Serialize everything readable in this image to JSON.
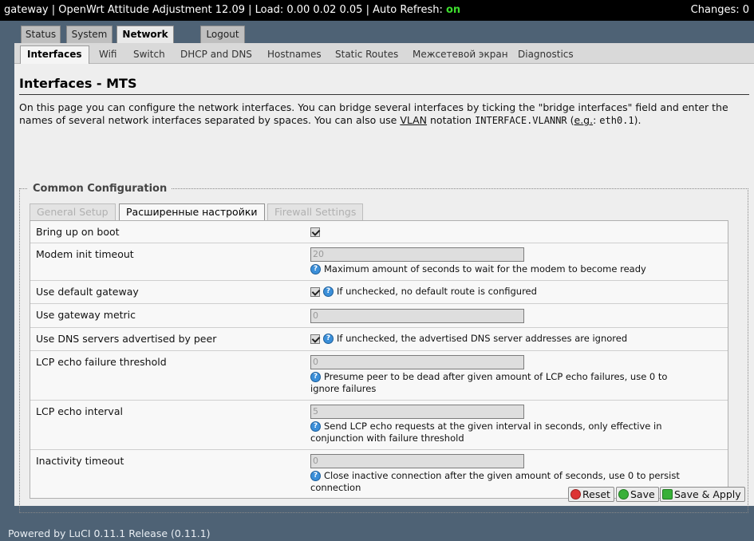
{
  "header": {
    "title": "gateway | OpenWrt Attitude Adjustment 12.09 | Load: 0.00 0.02 0.05 | Auto Refresh: ",
    "auto_refresh": "on",
    "changes": "Changes: 0"
  },
  "main_tabs": [
    "Status",
    "System",
    "Network",
    "Logout"
  ],
  "sub_tabs": [
    "Interfaces",
    "Wifi",
    "Switch",
    "DHCP and DNS",
    "Hostnames",
    "Static Routes",
    "Межсетевой экран",
    "Diagnostics"
  ],
  "page": {
    "title": "Interfaces - MTS",
    "desc_1": "On this page you can configure the network interfaces. You can bridge several interfaces by ticking the \"bridge interfaces\" field and enter the names of several network interfaces separated by spaces. You can also use ",
    "desc_vlan": "VLAN",
    "desc_2": " notation ",
    "desc_code1": "INTERFACE.VLANNR",
    "desc_3": " (",
    "desc_eg": "e.g.",
    "desc_4": ": ",
    "desc_code2": "eth0.1",
    "desc_5": ")."
  },
  "section": {
    "legend": "Common Configuration",
    "tabs": [
      "General Setup",
      "Расширенные настройки",
      "Firewall Settings"
    ]
  },
  "options": [
    {
      "label": "Bring up on boot",
      "checked": true
    },
    {
      "label": "Modem init timeout",
      "value": "20",
      "hint": "Maximum amount of seconds to wait for the modem to become ready"
    },
    {
      "label": "Use default gateway",
      "checked": true,
      "hint": "If unchecked, no default route is configured"
    },
    {
      "label": "Use gateway metric",
      "value": "0"
    },
    {
      "label": "Use DNS servers advertised by peer",
      "checked": true,
      "hint": "If unchecked, the advertised DNS server addresses are ignored"
    },
    {
      "label": "LCP echo failure threshold",
      "value": "0",
      "hint": "Presume peer to be dead after given amount of LCP echo failures, use 0 to ignore failures"
    },
    {
      "label": "LCP echo interval",
      "value": "5",
      "hint": "Send LCP echo requests at the given interval in seconds, only effective in conjunction with failure threshold"
    },
    {
      "label": "Inactivity timeout",
      "value": "0",
      "hint": "Close inactive connection after the given amount of seconds, use 0 to persist connection"
    }
  ],
  "buttons": {
    "reset": "Reset",
    "save": "Save",
    "save_apply": "Save & Apply"
  },
  "footer": "Powered by LuCI 0.11.1 Release (0.11.1)",
  "colors": {
    "accent_on": "#3ddc2d",
    "background": "#4e6275",
    "info_icon": "#3b8fd9"
  },
  "icons": {
    "hint": "help-icon",
    "reset": "reset-icon",
    "save": "save-icon",
    "save_apply": "apply-icon"
  }
}
